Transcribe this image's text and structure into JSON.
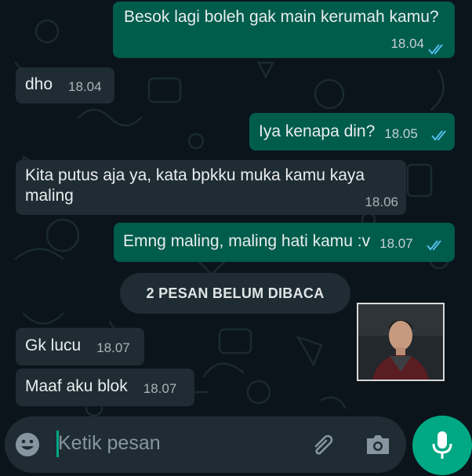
{
  "messages": [
    {
      "direction": "out",
      "text": "Besok lagi boleh gak main kerumah kamu?",
      "time": "18.04",
      "status": "read"
    },
    {
      "direction": "in",
      "text": "dho",
      "time": "18.04"
    },
    {
      "direction": "out",
      "text": "Iya kenapa din?",
      "time": "18.05",
      "status": "read"
    },
    {
      "direction": "in",
      "text_line1": "Kita putus aja ya, kata bpkku muka kamu kaya",
      "text_line2": "maling",
      "time": "18.06"
    },
    {
      "direction": "out",
      "text": "Emng maling, maling hati kamu :v",
      "time": "18.07",
      "status": "read"
    },
    {
      "direction": "in",
      "text": "Gk lucu",
      "time": "18.07"
    },
    {
      "direction": "in",
      "text": "Maaf aku blok",
      "time": "18.07"
    }
  ],
  "unread_banner": "2 PESAN BELUM DIBACA",
  "composer": {
    "placeholder": "Ketik pesan"
  },
  "icons": {
    "emoji": "emoji-icon",
    "attach": "paperclip-icon",
    "camera": "camera-icon",
    "mic": "microphone-icon",
    "read": "double-check-icon"
  },
  "colors": {
    "outgoing": "#005c4b",
    "incoming": "#1f2c33",
    "background": "#0b141a",
    "read_ticks": "#53bdeb",
    "accent": "#00a884"
  }
}
